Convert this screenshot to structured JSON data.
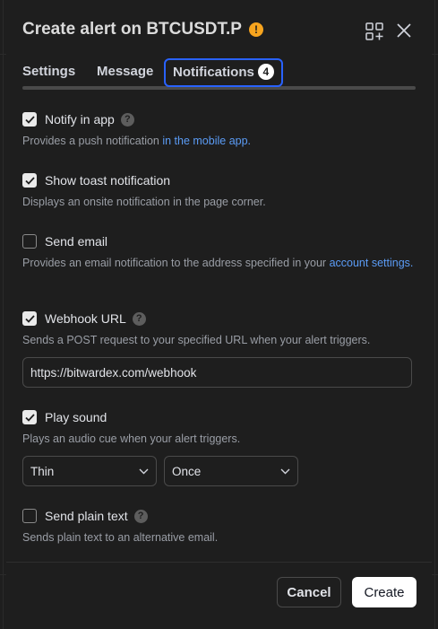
{
  "dialog": {
    "title": "Create alert on BTCUSDT.P",
    "warning_icon": "!"
  },
  "tabs": [
    {
      "label": "Settings"
    },
    {
      "label": "Message"
    },
    {
      "label": "Notifications",
      "badge": "4",
      "active": true
    }
  ],
  "options": {
    "notify_in_app": {
      "label": "Notify in app",
      "checked": true,
      "desc_prefix": "Provides a push notification ",
      "desc_link": "in the mobile app."
    },
    "toast": {
      "label": "Show toast notification",
      "checked": true,
      "desc": "Displays an onsite notification in the page corner."
    },
    "email": {
      "label": "Send email",
      "checked": false,
      "desc_prefix": "Provides an email notification to the address specified in your ",
      "desc_link": "account settings."
    },
    "webhook": {
      "label": "Webhook URL",
      "checked": true,
      "desc": "Sends a POST request to your specified URL when your alert triggers.",
      "url": "https://bitwardex.com/webhook"
    },
    "sound": {
      "label": "Play sound",
      "checked": true,
      "desc": "Plays an audio cue when your alert triggers.",
      "sound_value": "Thin",
      "repeat_value": "Once"
    },
    "plain_text": {
      "label": "Send plain text",
      "checked": false,
      "desc": "Sends plain text to an alternative email."
    }
  },
  "footer": {
    "cancel_label": "Cancel",
    "create_label": "Create"
  },
  "colors": {
    "accent": "#2962ff",
    "link": "#5b9cf6",
    "warning": "#f7a41e",
    "background": "#1e1e1e"
  }
}
